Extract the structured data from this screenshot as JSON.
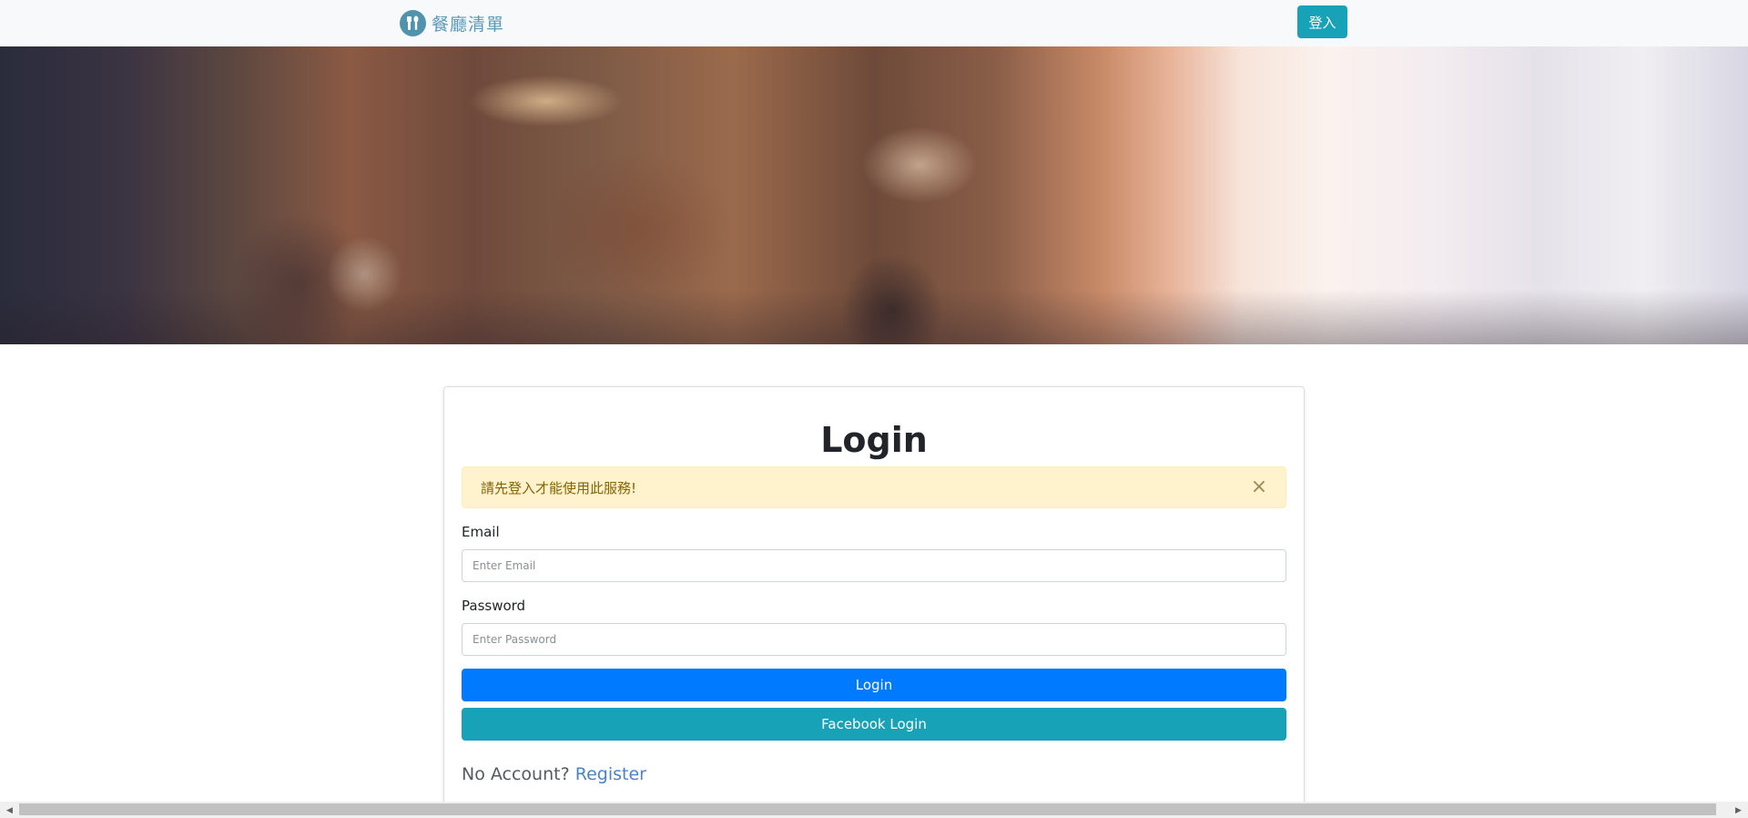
{
  "navbar": {
    "brand_text": "餐廳清單",
    "login_button": "登入"
  },
  "hero": {
    "description_icon": "blurred-restaurant-photo"
  },
  "login_card": {
    "title": "Login",
    "alert": {
      "message": "請先登入才能使用此服務!",
      "close_symbol": "×"
    },
    "email": {
      "label": "Email",
      "placeholder": "Enter Email",
      "value": ""
    },
    "password": {
      "label": "Password",
      "placeholder": "Enter Password",
      "value": ""
    },
    "login_button": "Login",
    "facebook_button": "Facebook Login",
    "register_prompt": "No Account?",
    "register_link": "Register"
  },
  "colors": {
    "primary": "#007bff",
    "info": "#17a2b8",
    "warning_bg": "#fff3cd",
    "warning_text": "#856404"
  }
}
